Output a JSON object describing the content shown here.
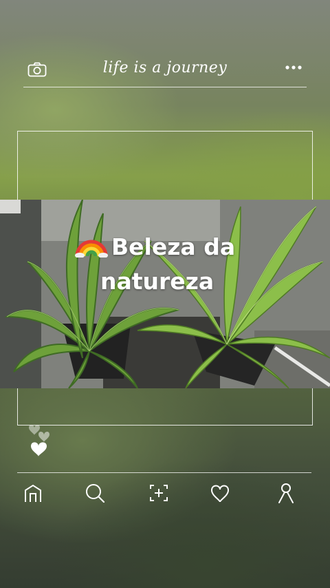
{
  "header": {
    "title": "life is a journey",
    "left_icon": "camera-icon",
    "right_icon": "more-dots-icon"
  },
  "post": {
    "caption_emoji": "rainbow-emoji",
    "caption_line1": "Beleza da",
    "caption_line2": "natureza"
  },
  "reactions": {
    "icon": "hearts-icon"
  },
  "nav": {
    "items": [
      {
        "name": "home",
        "icon": "home-icon"
      },
      {
        "name": "search",
        "icon": "search-icon"
      },
      {
        "name": "add",
        "icon": "add-photo-icon"
      },
      {
        "name": "likes",
        "icon": "heart-icon"
      },
      {
        "name": "profile",
        "icon": "profile-icon"
      }
    ]
  },
  "colors": {
    "overlay_line": "#ffffff",
    "text": "#ffffff"
  }
}
